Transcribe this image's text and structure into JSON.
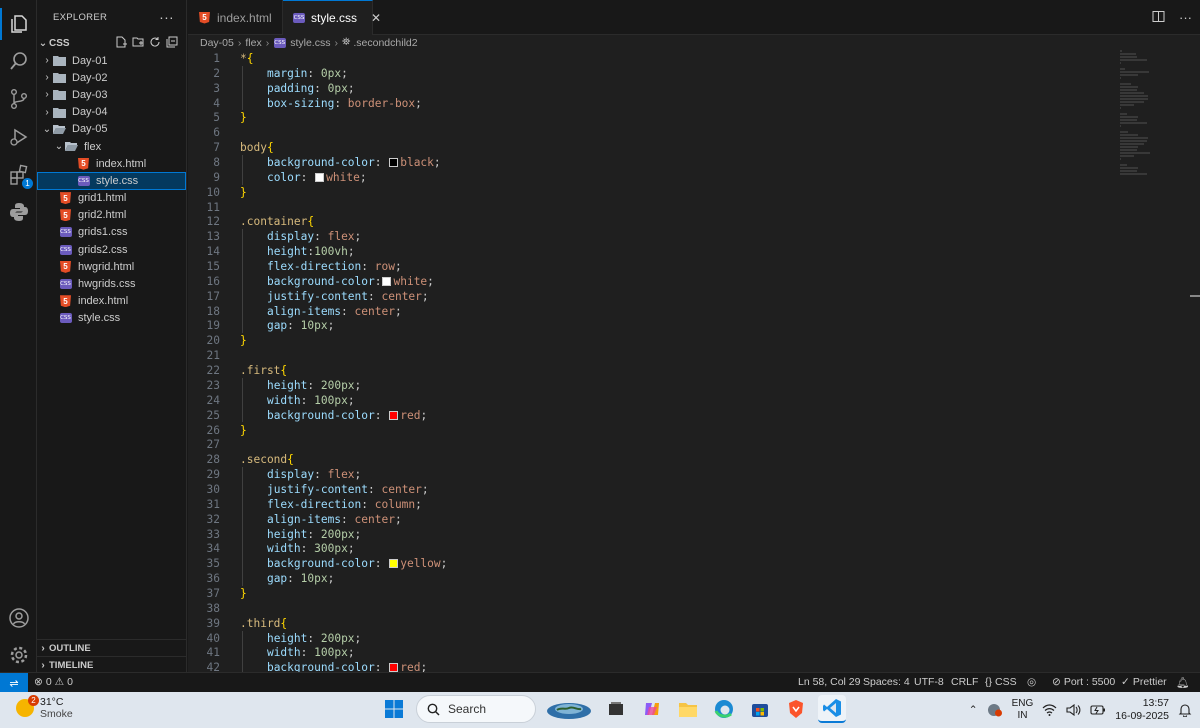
{
  "activity_bar": {
    "items": [
      {
        "name": "explorer-icon",
        "active": true
      },
      {
        "name": "search-icon",
        "active": false
      },
      {
        "name": "source-control-icon",
        "active": false
      },
      {
        "name": "run-debug-icon",
        "active": false
      },
      {
        "name": "extensions-icon",
        "active": false,
        "badge": "1"
      },
      {
        "name": "python-icon",
        "active": false
      }
    ],
    "bottom": [
      "account-icon",
      "settings-gear-icon"
    ]
  },
  "explorer": {
    "title": "EXPLORER",
    "root": "CSS",
    "tree": [
      {
        "label": "Day-01",
        "type": "folder",
        "depth": 1,
        "open": false
      },
      {
        "label": "Day-02",
        "type": "folder",
        "depth": 1,
        "open": false
      },
      {
        "label": "Day-03",
        "type": "folder",
        "depth": 1,
        "open": false
      },
      {
        "label": "Day-04",
        "type": "folder",
        "depth": 1,
        "open": false
      },
      {
        "label": "Day-05",
        "type": "folder",
        "depth": 1,
        "open": true
      },
      {
        "label": "flex",
        "type": "folder",
        "depth": 2,
        "open": true
      },
      {
        "label": "index.html",
        "type": "html",
        "depth": 3
      },
      {
        "label": "style.css",
        "type": "css",
        "depth": 3,
        "selected": true
      },
      {
        "label": "grid1.html",
        "type": "html",
        "depth": 2
      },
      {
        "label": "grid2.html",
        "type": "html",
        "depth": 2
      },
      {
        "label": "grids1.css",
        "type": "css",
        "depth": 2
      },
      {
        "label": "grids2.css",
        "type": "css",
        "depth": 2
      },
      {
        "label": "hwgrid.html",
        "type": "html",
        "depth": 2
      },
      {
        "label": "hwgrids.css",
        "type": "css",
        "depth": 2
      },
      {
        "label": "index.html",
        "type": "html",
        "depth": 2
      },
      {
        "label": "style.css",
        "type": "css",
        "depth": 2
      }
    ],
    "outline": "OUTLINE",
    "timeline": "TIMELINE"
  },
  "tabs": [
    {
      "label": "index.html",
      "type": "html",
      "active": false
    },
    {
      "label": "style.css",
      "type": "css",
      "active": true
    }
  ],
  "breadcrumb": [
    "Day-05",
    "flex",
    "style.css",
    ".secondchild2"
  ],
  "code": [
    [
      [
        "*",
        "sel"
      ],
      [
        "{",
        "brace"
      ]
    ],
    [
      [
        "    ",
        "plain"
      ],
      [
        "margin",
        "prop"
      ],
      [
        ": ",
        "plain"
      ],
      [
        "0px",
        "num"
      ],
      [
        ";",
        "plain"
      ]
    ],
    [
      [
        "    ",
        "plain"
      ],
      [
        "padding",
        "prop"
      ],
      [
        ": ",
        "plain"
      ],
      [
        "0px",
        "num"
      ],
      [
        ";",
        "plain"
      ]
    ],
    [
      [
        "    ",
        "plain"
      ],
      [
        "box-sizing",
        "prop"
      ],
      [
        ": ",
        "plain"
      ],
      [
        "border-box",
        "val"
      ],
      [
        ";",
        "plain"
      ]
    ],
    [
      [
        "}",
        "brace"
      ]
    ],
    [],
    [
      [
        "body",
        "sel"
      ],
      [
        "{",
        "brace"
      ]
    ],
    [
      [
        "    ",
        "plain"
      ],
      [
        "background-color",
        "prop"
      ],
      [
        ": ",
        "plain"
      ],
      [
        "#000000",
        "swatch"
      ],
      [
        "black",
        "val"
      ],
      [
        ";",
        "plain"
      ]
    ],
    [
      [
        "    ",
        "plain"
      ],
      [
        "color",
        "prop"
      ],
      [
        ": ",
        "plain"
      ],
      [
        "#ffffff",
        "swatch"
      ],
      [
        "white",
        "val"
      ],
      [
        ";",
        "plain"
      ]
    ],
    [
      [
        "}",
        "brace"
      ]
    ],
    [],
    [
      [
        ".container",
        "sel"
      ],
      [
        "{",
        "brace"
      ]
    ],
    [
      [
        "    ",
        "plain"
      ],
      [
        "display",
        "prop"
      ],
      [
        ": ",
        "plain"
      ],
      [
        "flex",
        "val"
      ],
      [
        ";",
        "plain"
      ]
    ],
    [
      [
        "    ",
        "plain"
      ],
      [
        "height",
        "prop"
      ],
      [
        ":",
        "plain"
      ],
      [
        "100vh",
        "num"
      ],
      [
        ";",
        "plain"
      ]
    ],
    [
      [
        "    ",
        "plain"
      ],
      [
        "flex-direction",
        "prop"
      ],
      [
        ": ",
        "plain"
      ],
      [
        "row",
        "val"
      ],
      [
        ";",
        "plain"
      ]
    ],
    [
      [
        "    ",
        "plain"
      ],
      [
        "background-color",
        "prop"
      ],
      [
        ":",
        "plain"
      ],
      [
        "#ffffff",
        "swatch"
      ],
      [
        "white",
        "val"
      ],
      [
        ";",
        "plain"
      ]
    ],
    [
      [
        "    ",
        "plain"
      ],
      [
        "justify-content",
        "prop"
      ],
      [
        ": ",
        "plain"
      ],
      [
        "center",
        "val"
      ],
      [
        ";",
        "plain"
      ]
    ],
    [
      [
        "    ",
        "plain"
      ],
      [
        "align-items",
        "prop"
      ],
      [
        ": ",
        "plain"
      ],
      [
        "center",
        "val"
      ],
      [
        ";",
        "plain"
      ]
    ],
    [
      [
        "    ",
        "plain"
      ],
      [
        "gap",
        "prop"
      ],
      [
        ": ",
        "plain"
      ],
      [
        "10px",
        "num"
      ],
      [
        ";",
        "plain"
      ]
    ],
    [
      [
        "}",
        "brace"
      ]
    ],
    [],
    [
      [
        ".first",
        "sel"
      ],
      [
        "{",
        "brace"
      ]
    ],
    [
      [
        "    ",
        "plain"
      ],
      [
        "height",
        "prop"
      ],
      [
        ": ",
        "plain"
      ],
      [
        "200px",
        "num"
      ],
      [
        ";",
        "plain"
      ]
    ],
    [
      [
        "    ",
        "plain"
      ],
      [
        "width",
        "prop"
      ],
      [
        ": ",
        "plain"
      ],
      [
        "100px",
        "num"
      ],
      [
        ";",
        "plain"
      ]
    ],
    [
      [
        "    ",
        "plain"
      ],
      [
        "background-color",
        "prop"
      ],
      [
        ": ",
        "plain"
      ],
      [
        "#ff0000",
        "swatch"
      ],
      [
        "red",
        "val"
      ],
      [
        ";",
        "plain"
      ]
    ],
    [
      [
        "}",
        "brace"
      ]
    ],
    [],
    [
      [
        ".second",
        "sel"
      ],
      [
        "{",
        "brace"
      ]
    ],
    [
      [
        "    ",
        "plain"
      ],
      [
        "display",
        "prop"
      ],
      [
        ": ",
        "plain"
      ],
      [
        "flex",
        "val"
      ],
      [
        ";",
        "plain"
      ]
    ],
    [
      [
        "    ",
        "plain"
      ],
      [
        "justify-content",
        "prop"
      ],
      [
        ": ",
        "plain"
      ],
      [
        "center",
        "val"
      ],
      [
        ";",
        "plain"
      ]
    ],
    [
      [
        "    ",
        "plain"
      ],
      [
        "flex-direction",
        "prop"
      ],
      [
        ": ",
        "plain"
      ],
      [
        "column",
        "val"
      ],
      [
        ";",
        "plain"
      ]
    ],
    [
      [
        "    ",
        "plain"
      ],
      [
        "align-items",
        "prop"
      ],
      [
        ": ",
        "plain"
      ],
      [
        "center",
        "val"
      ],
      [
        ";",
        "plain"
      ]
    ],
    [
      [
        "    ",
        "plain"
      ],
      [
        "height",
        "prop"
      ],
      [
        ": ",
        "plain"
      ],
      [
        "200px",
        "num"
      ],
      [
        ";",
        "plain"
      ]
    ],
    [
      [
        "    ",
        "plain"
      ],
      [
        "width",
        "prop"
      ],
      [
        ": ",
        "plain"
      ],
      [
        "300px",
        "num"
      ],
      [
        ";",
        "plain"
      ]
    ],
    [
      [
        "    ",
        "plain"
      ],
      [
        "background-color",
        "prop"
      ],
      [
        ": ",
        "plain"
      ],
      [
        "#ffff00",
        "swatch"
      ],
      [
        "yellow",
        "val"
      ],
      [
        ";",
        "plain"
      ]
    ],
    [
      [
        "    ",
        "plain"
      ],
      [
        "gap",
        "prop"
      ],
      [
        ": ",
        "plain"
      ],
      [
        "10px",
        "num"
      ],
      [
        ";",
        "plain"
      ]
    ],
    [
      [
        "}",
        "brace"
      ]
    ],
    [],
    [
      [
        ".third",
        "sel"
      ],
      [
        "{",
        "brace"
      ]
    ],
    [
      [
        "    ",
        "plain"
      ],
      [
        "height",
        "prop"
      ],
      [
        ": ",
        "plain"
      ],
      [
        "200px",
        "num"
      ],
      [
        ";",
        "plain"
      ]
    ],
    [
      [
        "    ",
        "plain"
      ],
      [
        "width",
        "prop"
      ],
      [
        ": ",
        "plain"
      ],
      [
        "100px",
        "num"
      ],
      [
        ";",
        "plain"
      ]
    ],
    [
      [
        "    ",
        "plain"
      ],
      [
        "background-color",
        "prop"
      ],
      [
        ": ",
        "plain"
      ],
      [
        "#ff0000",
        "swatch"
      ],
      [
        "red",
        "val"
      ],
      [
        ";",
        "plain"
      ]
    ]
  ],
  "status_bar": {
    "errors": "0",
    "warnings": "0",
    "position": "Ln 58, Col 29",
    "spaces": "Spaces: 4",
    "encoding": "UTF-8",
    "eol": "CRLF",
    "language": "CSS",
    "port": "Port : 5500",
    "prettier": "Prettier"
  },
  "taskbar": {
    "weather_badge": "2",
    "temperature": "31°C",
    "condition": "Smoke",
    "search_placeholder": "Search",
    "lang_line1": "ENG",
    "lang_line2": "IN",
    "time": "13:57",
    "date": "16-09-2025"
  },
  "colors": {
    "accent": "#0078d4",
    "html_icon": "#e44d26",
    "css_icon": "#6b5bbd"
  }
}
